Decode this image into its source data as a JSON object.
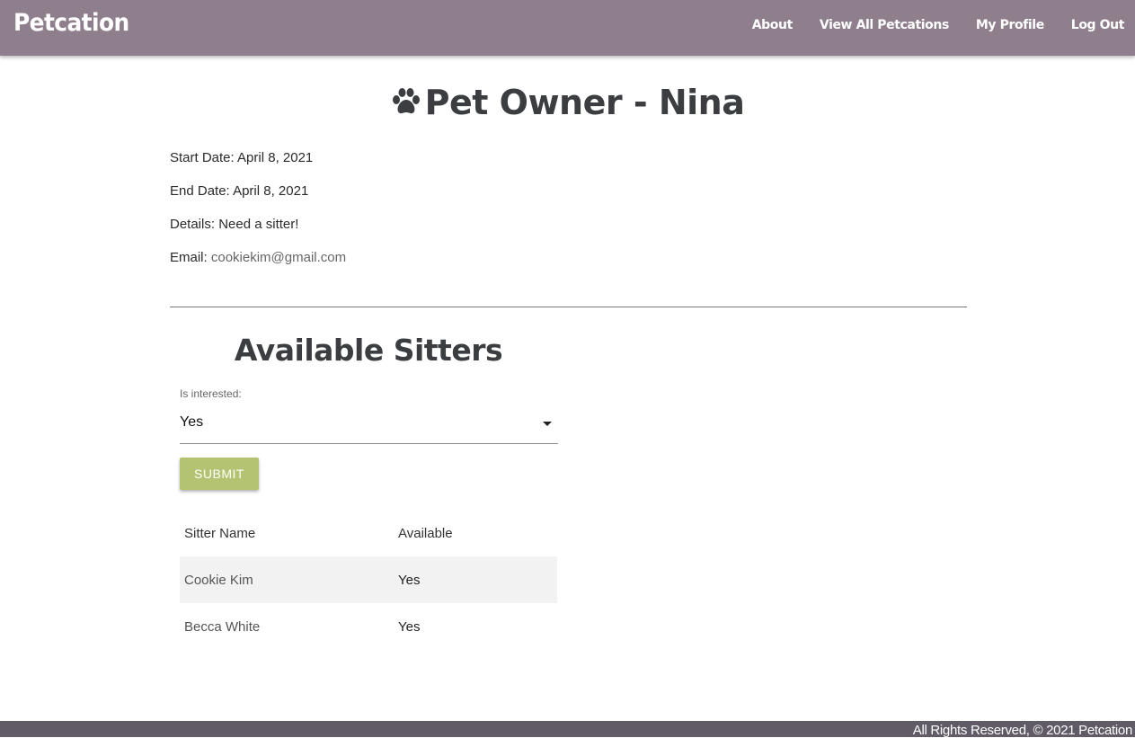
{
  "navbar": {
    "brand": "Petcation",
    "links": [
      "About",
      "View All Petcations",
      "My Profile",
      "Log Out"
    ],
    "background": "#8f7f8d"
  },
  "page": {
    "title_icon": "paw-icon",
    "title": "Pet Owner - Nina"
  },
  "details": {
    "start_label": "Start Date:",
    "start_value": "April 8, 2021",
    "end_label": "End Date:",
    "end_value": "April 8, 2021",
    "details_label": "Details:",
    "details_value": "Need a sitter!",
    "email_label": "Email:",
    "email_value": "cookiekim@gmail.com"
  },
  "sitters_section": {
    "title": "Available Sitters",
    "field_label": "Is interested:",
    "selected": "Yes",
    "submit_label": "SUBMIT",
    "submit_color": "#b3c371",
    "columns": [
      "Sitter Name",
      "Available"
    ],
    "rows": [
      {
        "name": "Cookie Kim",
        "available": "Yes"
      },
      {
        "name": "Becca White",
        "available": "Yes"
      }
    ]
  },
  "footer": {
    "text": "All Rights Reserved, © 2021 Petcation",
    "background": "#615b67"
  }
}
